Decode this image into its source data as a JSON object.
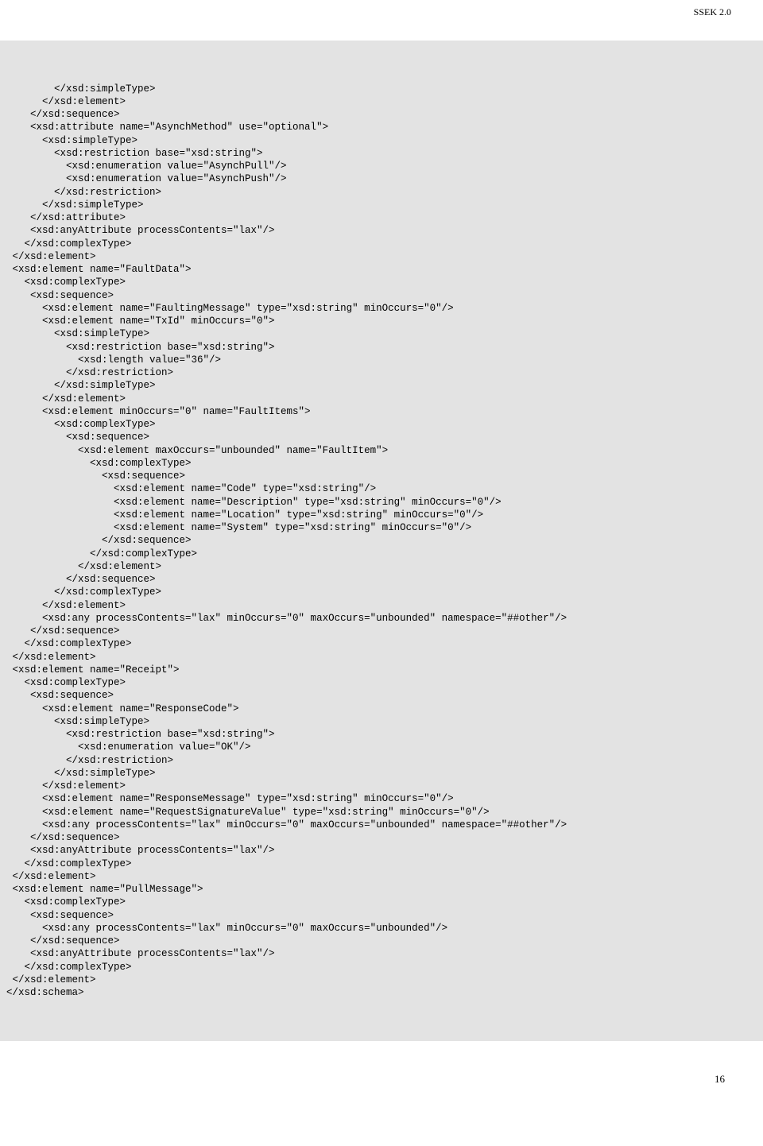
{
  "header": {
    "doc_title": "SSEK 2.0"
  },
  "code": {
    "text": "        </xsd:simpleType>\n      </xsd:element>\n    </xsd:sequence>\n    <xsd:attribute name=\"AsynchMethod\" use=\"optional\">\n      <xsd:simpleType>\n        <xsd:restriction base=\"xsd:string\">\n          <xsd:enumeration value=\"AsynchPull\"/>\n          <xsd:enumeration value=\"AsynchPush\"/>\n        </xsd:restriction>\n      </xsd:simpleType>\n    </xsd:attribute>\n    <xsd:anyAttribute processContents=\"lax\"/>\n   </xsd:complexType>\n </xsd:element>\n <xsd:element name=\"FaultData\">\n   <xsd:complexType>\n    <xsd:sequence>\n      <xsd:element name=\"FaultingMessage\" type=\"xsd:string\" minOccurs=\"0\"/>\n      <xsd:element name=\"TxId\" minOccurs=\"0\">\n        <xsd:simpleType>\n          <xsd:restriction base=\"xsd:string\">\n            <xsd:length value=\"36\"/>\n          </xsd:restriction>\n        </xsd:simpleType>\n      </xsd:element>\n      <xsd:element minOccurs=\"0\" name=\"FaultItems\">\n        <xsd:complexType>\n          <xsd:sequence>\n            <xsd:element maxOccurs=\"unbounded\" name=\"FaultItem\">\n              <xsd:complexType>\n                <xsd:sequence>\n                  <xsd:element name=\"Code\" type=\"xsd:string\"/>\n                  <xsd:element name=\"Description\" type=\"xsd:string\" minOccurs=\"0\"/>\n                  <xsd:element name=\"Location\" type=\"xsd:string\" minOccurs=\"0\"/>\n                  <xsd:element name=\"System\" type=\"xsd:string\" minOccurs=\"0\"/>\n                </xsd:sequence>\n              </xsd:complexType>\n            </xsd:element>\n          </xsd:sequence>\n        </xsd:complexType>\n      </xsd:element>\n      <xsd:any processContents=\"lax\" minOccurs=\"0\" maxOccurs=\"unbounded\" namespace=\"##other\"/>\n    </xsd:sequence>\n   </xsd:complexType>\n </xsd:element>\n <xsd:element name=\"Receipt\">\n   <xsd:complexType>\n    <xsd:sequence>\n      <xsd:element name=\"ResponseCode\">\n        <xsd:simpleType>\n          <xsd:restriction base=\"xsd:string\">\n            <xsd:enumeration value=\"OK\"/>\n          </xsd:restriction>\n        </xsd:simpleType>\n      </xsd:element>\n      <xsd:element name=\"ResponseMessage\" type=\"xsd:string\" minOccurs=\"0\"/>\n      <xsd:element name=\"RequestSignatureValue\" type=\"xsd:string\" minOccurs=\"0\"/>\n      <xsd:any processContents=\"lax\" minOccurs=\"0\" maxOccurs=\"unbounded\" namespace=\"##other\"/>\n    </xsd:sequence>\n    <xsd:anyAttribute processContents=\"lax\"/>\n   </xsd:complexType>\n </xsd:element>\n <xsd:element name=\"PullMessage\">\n   <xsd:complexType>\n    <xsd:sequence>\n      <xsd:any processContents=\"lax\" minOccurs=\"0\" maxOccurs=\"unbounded\"/>\n    </xsd:sequence>\n    <xsd:anyAttribute processContents=\"lax\"/>\n   </xsd:complexType>\n </xsd:element>\n</xsd:schema>"
  },
  "footer": {
    "page_number": "16"
  }
}
